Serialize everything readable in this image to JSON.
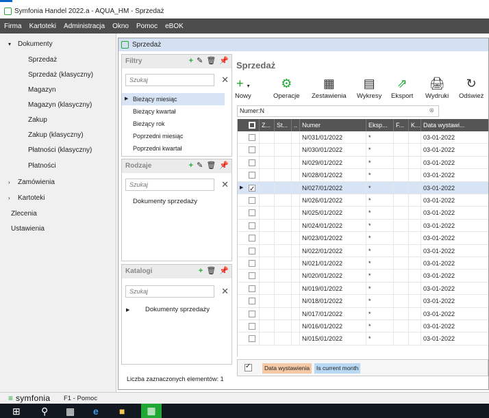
{
  "window": {
    "title": "Symfonia Handel 2022.a - AQUA_HM - Sprzedaż"
  },
  "menu": [
    "Firma",
    "Kartoteki",
    "Administracja",
    "Okno",
    "Pomoc",
    "eBOK"
  ],
  "nav": {
    "items": [
      {
        "label": "Dokumenty",
        "caret": "▾",
        "level": 0
      },
      {
        "label": "Sprzedaż",
        "level": 1
      },
      {
        "label": "Sprzedaż (klasyczny)",
        "level": 1
      },
      {
        "label": "Magazyn",
        "level": 1
      },
      {
        "label": "Magazyn (klasyczny)",
        "level": 1
      },
      {
        "label": "Zakup",
        "level": 1
      },
      {
        "label": "Zakup (klasyczny)",
        "level": 1
      },
      {
        "label": "Płatności (klasyczny)",
        "level": 1
      },
      {
        "label": "Płatności",
        "level": 1
      },
      {
        "label": "Zamówienia",
        "caret": "›",
        "level": 0
      },
      {
        "label": "Kartoteki",
        "caret": "›",
        "level": 0
      },
      {
        "label": "Zlecenia",
        "level": 2
      },
      {
        "label": "Ustawienia",
        "level": 2
      }
    ]
  },
  "document_tab": {
    "title": "Sprzedaż"
  },
  "filters_panel": {
    "title": "Filtry",
    "search_placeholder": "Szukaj",
    "items": [
      "Bieżący miesiąc",
      "Bieżący kwartał",
      "Bieżący rok",
      "Poprzedni miesiąc",
      "Poprzedni kwartał"
    ],
    "selected_index": 0
  },
  "kinds_panel": {
    "title": "Rodzaje",
    "search_placeholder": "Szukaj",
    "items": [
      "Dokumenty sprzedaży"
    ]
  },
  "catalogs_panel": {
    "title": "Katalogi",
    "search_placeholder": "Szukaj",
    "items": [
      "Dokumenty sprzedaży"
    ]
  },
  "summary": "Liczba zaznaczonych elementów: 1",
  "main": {
    "title": "Sprzedaż",
    "toolbar": [
      "Nowy",
      "Operacje",
      "Zestawienia",
      "Wykresy",
      "Eksport",
      "Wydruki",
      "Odśwież"
    ],
    "filter_text": "Numer:N",
    "columns": [
      "Z...",
      "St...",
      "..",
      "Numer",
      "Eksp...",
      "F...",
      "K...",
      "Data wystawi..."
    ],
    "rows": [
      {
        "numer": "N/031/01/2022",
        "eksp": "*",
        "data": "03-01-2022",
        "checked": false
      },
      {
        "numer": "N/030/01/2022",
        "eksp": "*",
        "data": "03-01-2022",
        "checked": false
      },
      {
        "numer": "N/029/01/2022",
        "eksp": "*",
        "data": "03-01-2022",
        "checked": false
      },
      {
        "numer": "N/028/01/2022",
        "eksp": "*",
        "data": "03-01-2022",
        "checked": false
      },
      {
        "numer": "N/027/01/2022",
        "eksp": "*",
        "data": "03-01-2022",
        "checked": true
      },
      {
        "numer": "N/026/01/2022",
        "eksp": "*",
        "data": "03-01-2022",
        "checked": false
      },
      {
        "numer": "N/025/01/2022",
        "eksp": "*",
        "data": "03-01-2022",
        "checked": false
      },
      {
        "numer": "N/024/01/2022",
        "eksp": "*",
        "data": "03-01-2022",
        "checked": false
      },
      {
        "numer": "N/023/01/2022",
        "eksp": "*",
        "data": "03-01-2022",
        "checked": false
      },
      {
        "numer": "N/022/01/2022",
        "eksp": "*",
        "data": "03-01-2022",
        "checked": false
      },
      {
        "numer": "N/021/01/2022",
        "eksp": "*",
        "data": "03-01-2022",
        "checked": false
      },
      {
        "numer": "N/020/01/2022",
        "eksp": "*",
        "data": "03-01-2022",
        "checked": false
      },
      {
        "numer": "N/019/01/2022",
        "eksp": "*",
        "data": "03-01-2022",
        "checked": false
      },
      {
        "numer": "N/018/01/2022",
        "eksp": "*",
        "data": "03-01-2022",
        "checked": false
      },
      {
        "numer": "N/017/01/2022",
        "eksp": "*",
        "data": "03-01-2022",
        "checked": false
      },
      {
        "numer": "N/016/01/2022",
        "eksp": "*",
        "data": "03-01-2022",
        "checked": false
      },
      {
        "numer": "N/015/01/2022",
        "eksp": "*",
        "data": "03-01-2022",
        "checked": false
      }
    ],
    "active_filter_chips": [
      "Data wystawienia",
      "Is current month"
    ]
  },
  "statusbar": {
    "logo": "symfonia",
    "help": "F1 - Pomoc"
  },
  "colors": {
    "accent_green": "#21a834",
    "menubar": "#4d4d4d",
    "selection": "#d6e4f5",
    "chip_orange": "#f6c9a6",
    "chip_blue": "#b9d8f4"
  }
}
